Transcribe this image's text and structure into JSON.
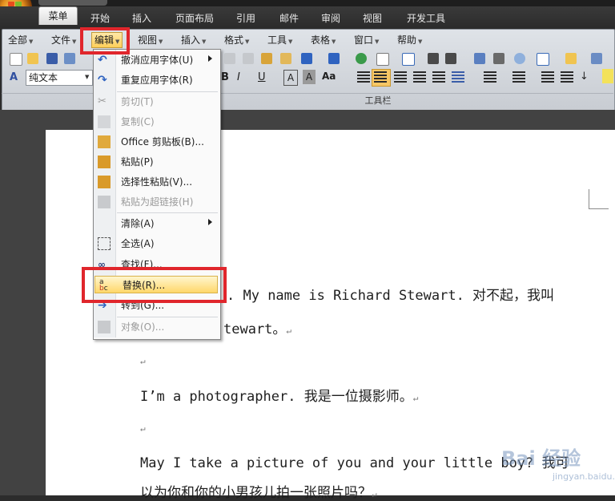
{
  "ribbon": {
    "tabs": [
      "菜单",
      "开始",
      "插入",
      "页面布局",
      "引用",
      "邮件",
      "审阅",
      "视图",
      "开发工具"
    ],
    "active_tab": "菜单",
    "menus": [
      "全部",
      "文件",
      "编辑",
      "视图",
      "插入",
      "格式",
      "工具",
      "表格",
      "窗口",
      "帮助"
    ],
    "open_menu": "编辑",
    "style_value": "纯文本",
    "group_label": "工具栏"
  },
  "edit_menu": {
    "items": [
      {
        "label": "撤消应用字体(U)",
        "icon": "undo-icon",
        "disabled": false,
        "submenu": true
      },
      {
        "label": "重复应用字体(R)",
        "icon": "redo-icon",
        "disabled": false,
        "submenu": false
      },
      {
        "label": "剪切(T)",
        "icon": "cut-icon",
        "disabled": true,
        "submenu": false
      },
      {
        "label": "复制(C)",
        "icon": "copy-icon",
        "disabled": true,
        "submenu": false
      },
      {
        "label": "Office 剪贴板(B)...",
        "icon": "clipboard-icon",
        "disabled": false,
        "submenu": false
      },
      {
        "label": "粘贴(P)",
        "icon": "paste-icon",
        "disabled": false,
        "submenu": false
      },
      {
        "label": "选择性粘贴(V)...",
        "icon": "paste-special-icon",
        "disabled": false,
        "submenu": false
      },
      {
        "label": "粘贴为超链接(H)",
        "icon": "paste-hyperlink-icon",
        "disabled": true,
        "submenu": false
      },
      {
        "label": "清除(A)",
        "icon": "",
        "disabled": false,
        "submenu": true
      },
      {
        "label": "全选(A)",
        "icon": "select-all-icon",
        "disabled": false,
        "submenu": false
      },
      {
        "label": "查找(F)...",
        "icon": "binoculars-icon",
        "disabled": false,
        "submenu": false
      },
      {
        "label": "替换(R)...",
        "icon": "replace-icon",
        "disabled": false,
        "submenu": false,
        "highlighted": true
      },
      {
        "label": "转到(G)...",
        "icon": "goto-icon",
        "disabled": false,
        "submenu": false
      },
      {
        "label": "对象(O)...",
        "icon": "object-icon",
        "disabled": true,
        "submenu": false
      }
    ]
  },
  "document": {
    "line1": "My name is Richard Stewart. 对不起，我叫",
    "line2": "tewart。",
    "line3": "I’m a photographer. 我是一位摄影师。",
    "line4": "May I take a picture of you and your little boy? 我可",
    "line5": "以为你和你的小男孩儿拍一张照片吗？",
    "para_mark": "↵"
  },
  "watermark": {
    "brand": "Bai 经验",
    "url": "jingyan.baidu.com"
  },
  "colors": {
    "highlight_box": "#e0262c",
    "menu_hover": "#ffd76a"
  }
}
